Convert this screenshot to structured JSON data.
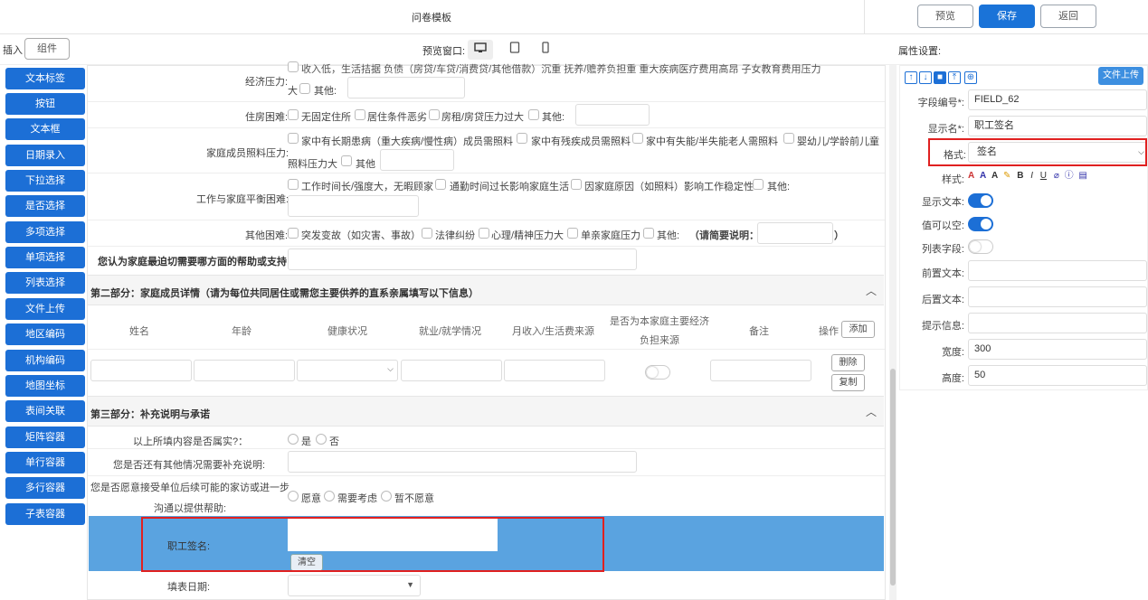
{
  "header": {
    "title": "问卷模板",
    "preview_label": "预览",
    "save_label": "保存",
    "back_label": "返回"
  },
  "subbar": {
    "insert_label": "插入",
    "component_tab": "组件",
    "preview_window_label": "预览窗口:",
    "properties_label": "属性设置:"
  },
  "sidebar": {
    "items": [
      "文本标签",
      "按钮",
      "文本框",
      "日期录入",
      "下拉选择",
      "是否选择",
      "多项选择",
      "单项选择",
      "列表选择",
      "文件上传",
      "地区编码",
      "机构编码",
      "地图坐标",
      "表间关联",
      "矩阵容器",
      "单行容器",
      "多行容器",
      "子表容器"
    ]
  },
  "form": {
    "economic": {
      "top_line": "收入低，生活拮据   负债（房贷/车贷/消费贷/其他借款）沉重   抚养/赡养负担重   重大疾病医疗费用高昂   子女教育费用压力",
      "label": "经济压力:",
      "cont": "大",
      "other": "其他:"
    },
    "housing": {
      "label": "住房困难:",
      "opt1": "无固定住所",
      "opt2": "居住条件恶劣",
      "opt3": "房租/房贷压力过大",
      "other": "其他:"
    },
    "care": {
      "label": "家庭成员照料压力:",
      "opt1": "家中有长期患病（重大疾病/慢性病）成员需照料",
      "opt2": "家中有残疾成员需照料",
      "opt3": "家中有失能/半失能老人需照料",
      "opt4": "婴幼儿/学龄前儿童",
      "line2": "照料压力大",
      "other": "其他"
    },
    "worklife": {
      "label": "工作与家庭平衡困难:",
      "opt1": "工作时间长/强度大，无暇顾家",
      "opt2": "通勤时间过长影响家庭生活",
      "opt3": "因家庭原因（如照料）影响工作稳定性",
      "other": "其他:"
    },
    "othertrouble": {
      "label": "其他困难:",
      "opt1": "突发变故（如灾害、事故）",
      "opt2": "法律纠纷",
      "opt3": "心理/精神压力大",
      "opt4": "单亲家庭压力",
      "other": "其他:",
      "note": "（请简要说明：",
      "close": "）"
    },
    "help_question": "您认为家庭最迫切需要哪方面的帮助或支持:",
    "section2": {
      "title": "第二部分：家庭成员详情（请为每位共同居住或需您主要供养的直系亲属填写以下信息）",
      "columns": [
        "姓名",
        "年龄",
        "健康状况",
        "就业/就学情况",
        "月收入/生活费来源",
        "是否为本家庭主要经济负担来源",
        "备注"
      ],
      "op_label": "操作",
      "add_label": "添加",
      "delete_label": "删除",
      "copy_label": "复制"
    },
    "section3": {
      "title": "第三部分：补充说明与承诺",
      "q1": "以上所填内容是否属实?：",
      "q1_yes": "是",
      "q1_no": "否",
      "q2": "您是否还有其他情况需要补充说明:",
      "q3_line1": "您是否愿意接受单位后续可能的家访或进一步",
      "q3_line2": "沟通以提供帮助:",
      "q3_opt1": "愿意",
      "q3_opt2": "需要考虑",
      "q3_opt3": "暂不愿意",
      "sign_label": "职工签名:",
      "clear_label": "清空",
      "date_label": "填表日期:"
    }
  },
  "props": {
    "upload_label": "文件上传",
    "field_code_label": "字段编号*:",
    "field_code_value": "FIELD_62",
    "display_name_label": "显示名*:",
    "display_name_value": "职工签名",
    "format_label": "格式:",
    "format_value": "签名",
    "style_label": "样式:",
    "show_text_label": "显示文本:",
    "nullable_label": "值可以空:",
    "list_field_label": "列表字段:",
    "prefix_label": "前置文本:",
    "suffix_label": "后置文本:",
    "hint_label": "提示信息:",
    "width_label": "宽度:",
    "width_value": "300",
    "height_label": "高度:",
    "height_value": "50"
  },
  "colors": {
    "primary": "#1c6fd6",
    "highlight_row": "#5aa3e0",
    "annotation": "#e02020"
  }
}
